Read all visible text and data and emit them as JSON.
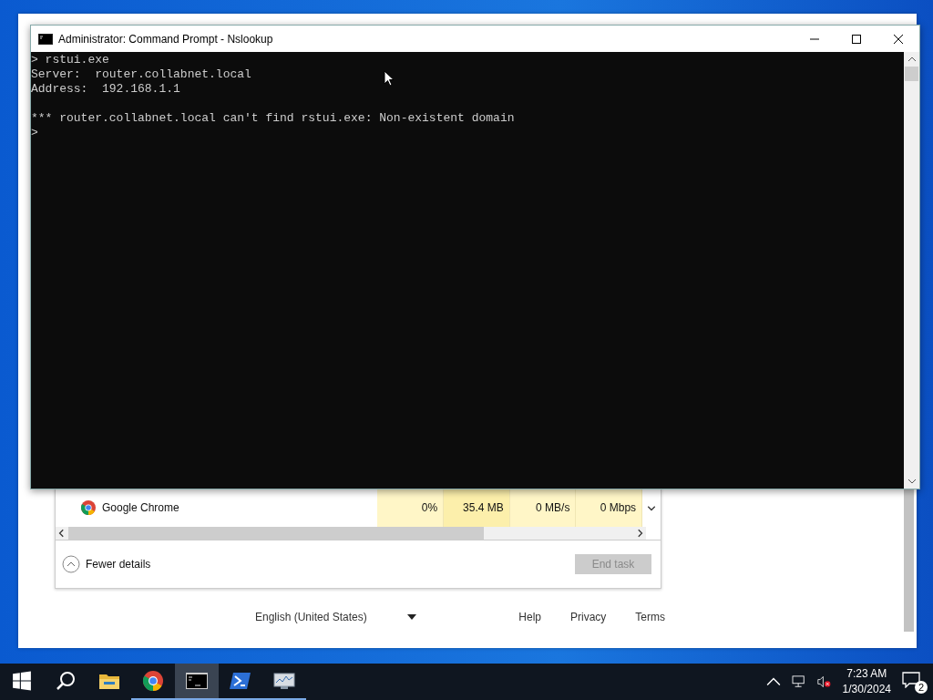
{
  "cmd_window": {
    "title": "Administrator: Command Prompt - Nslookup",
    "blocks": [
      [
        "> rstui.exe",
        "Server:  router.collabnet.local",
        "Address:  192.168.1.1"
      ],
      [
        "*** router.collabnet.local can't find rstui.exe: Non-existent domain",
        ">"
      ]
    ]
  },
  "task_manager": {
    "rows": [
      {
        "name": "Google Chrome",
        "cpu": "0%",
        "memory": "35.4 MB",
        "disk": "0 MB/s",
        "network": "0 Mbps"
      }
    ],
    "fewer_details": "Fewer details",
    "end_task": {
      "label": "End task",
      "disabled": true
    }
  },
  "footer": {
    "language": "English (United States)",
    "links": [
      "Help",
      "Privacy",
      "Terms"
    ]
  },
  "taskbar": {
    "apps": [
      {
        "kind": "explorer",
        "running": false,
        "selected": false
      },
      {
        "kind": "chrome",
        "running": true,
        "selected": false
      },
      {
        "kind": "cmd",
        "running": true,
        "selected": true
      },
      {
        "kind": "powershell",
        "running": true,
        "selected": false
      },
      {
        "kind": "monitor",
        "running": true,
        "selected": false
      }
    ],
    "time": "7:23 AM",
    "date": "1/30/2024",
    "notifications": "2"
  }
}
